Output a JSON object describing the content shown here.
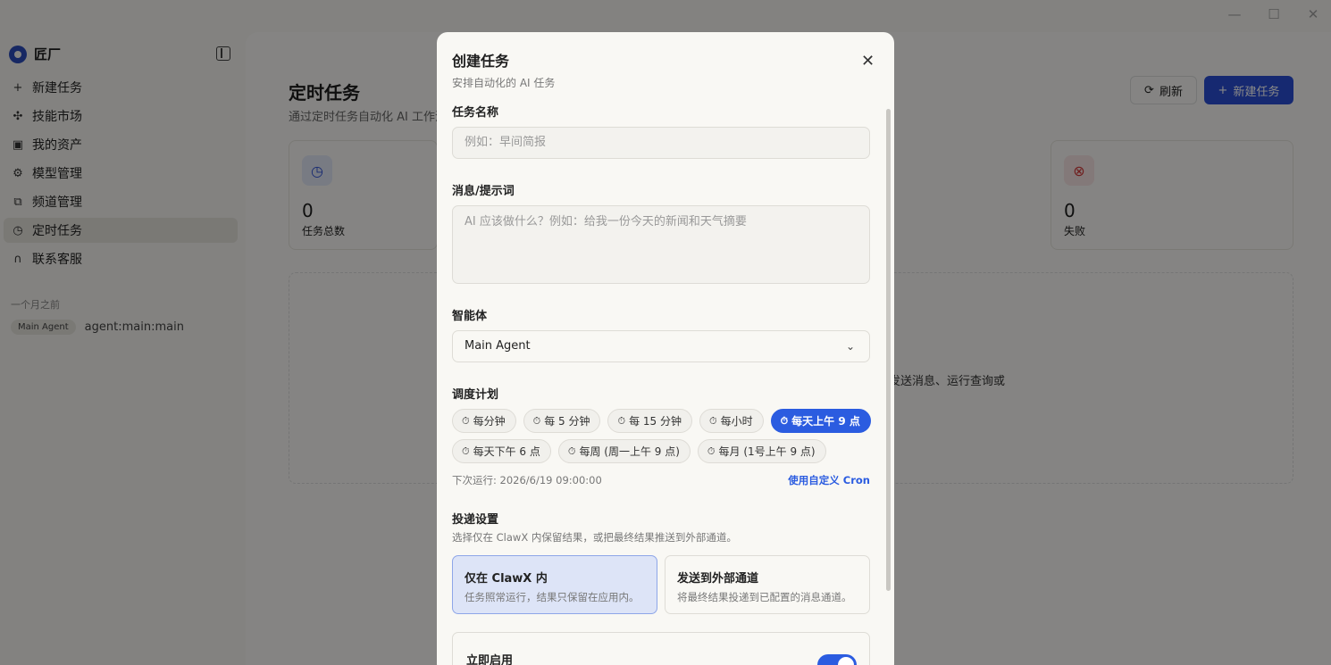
{
  "window": {
    "minimize": "—",
    "maximize": "☐",
    "close": "✕"
  },
  "app": {
    "name": "匠厂"
  },
  "sidebar": {
    "items": [
      {
        "icon": "plus-icon",
        "glyph": "+",
        "label": "新建任务"
      },
      {
        "icon": "puzzle-icon",
        "glyph": "✣",
        "label": "技能市场"
      },
      {
        "icon": "wallet-icon",
        "glyph": "▣",
        "label": "我的资产"
      },
      {
        "icon": "chip-icon",
        "glyph": "⚙",
        "label": "模型管理"
      },
      {
        "icon": "channels-icon",
        "glyph": "⧉",
        "label": "频道管理"
      },
      {
        "icon": "clock-icon",
        "glyph": "◷",
        "label": "定时任务"
      },
      {
        "icon": "headset-icon",
        "glyph": "∩",
        "label": "联系客服"
      }
    ],
    "active_index": 5,
    "section_label": "一个月之前",
    "history": {
      "badge": "Main Agent",
      "id": "agent:main:main"
    }
  },
  "main": {
    "title": "定时任务",
    "subtitle": "通过定时任务自动化 AI 工作流",
    "refresh_label": "刷新",
    "new_task_label": "新建任务",
    "stats": [
      {
        "value": "0",
        "label": "任务总数",
        "icon": "clock-icon",
        "color": "#2b4fd6"
      },
      {
        "value": "0",
        "label": "失败",
        "icon": "error-icon",
        "color": "#d33a3a"
      }
    ],
    "empty_text": "发送消息、运行查询或"
  },
  "modal": {
    "title": "创建任务",
    "subtitle": "安排自动化的 AI 任务",
    "name_label": "任务名称",
    "name_placeholder": "例如：早间简报",
    "message_label": "消息/提示词",
    "message_placeholder": "AI 应该做什么？例如：给我一份今天的新闻和天气摘要",
    "agent_label": "智能体",
    "agent_value": "Main Agent",
    "schedule_label": "调度计划",
    "schedule_options": [
      "每分钟",
      "每 5 分钟",
      "每 15 分钟",
      "每小时",
      "每天上午 9 点",
      "每天下午 6 点",
      "每周 (周一上午 9 点)",
      "每月 (1号上午 9 点)"
    ],
    "schedule_selected_index": 4,
    "next_run": "下次运行: 2026/6/19 09:00:00",
    "custom_cron": "使用自定义 Cron",
    "delivery_label": "投递设置",
    "delivery_desc": "选择仅在 ClawX 内保留结果，或把最终结果推送到外部通道。",
    "delivery_options": [
      {
        "title": "仅在 ClawX 内",
        "desc": "任务照常运行，结果只保留在应用内。"
      },
      {
        "title": "发送到外部通道",
        "desc": "将最终结果投递到已配置的消息通道。"
      }
    ],
    "enable_label": "立即启用",
    "enable_on": true
  }
}
